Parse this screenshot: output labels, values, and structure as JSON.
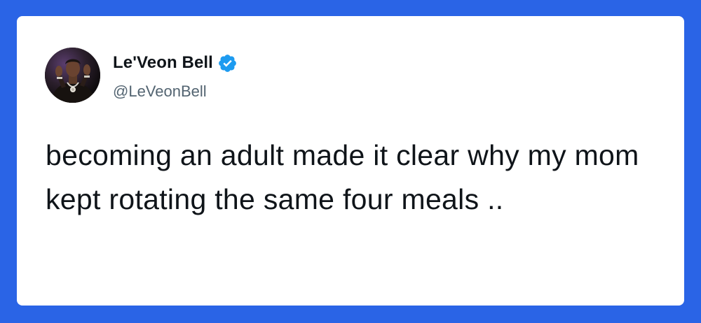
{
  "tweet": {
    "author": {
      "display_name": "Le'Veon Bell",
      "handle": "@LeVeonBell",
      "verified": true,
      "avatar_icon": "profile-photo"
    },
    "text": "becoming an adult made it clear why my mom kept rotating the same four meals .."
  },
  "colors": {
    "background": "#2A64E6",
    "card": "#FFFFFF",
    "text": "#0F1419",
    "handle": "#536471",
    "verified_badge": "#1D9BF0"
  }
}
